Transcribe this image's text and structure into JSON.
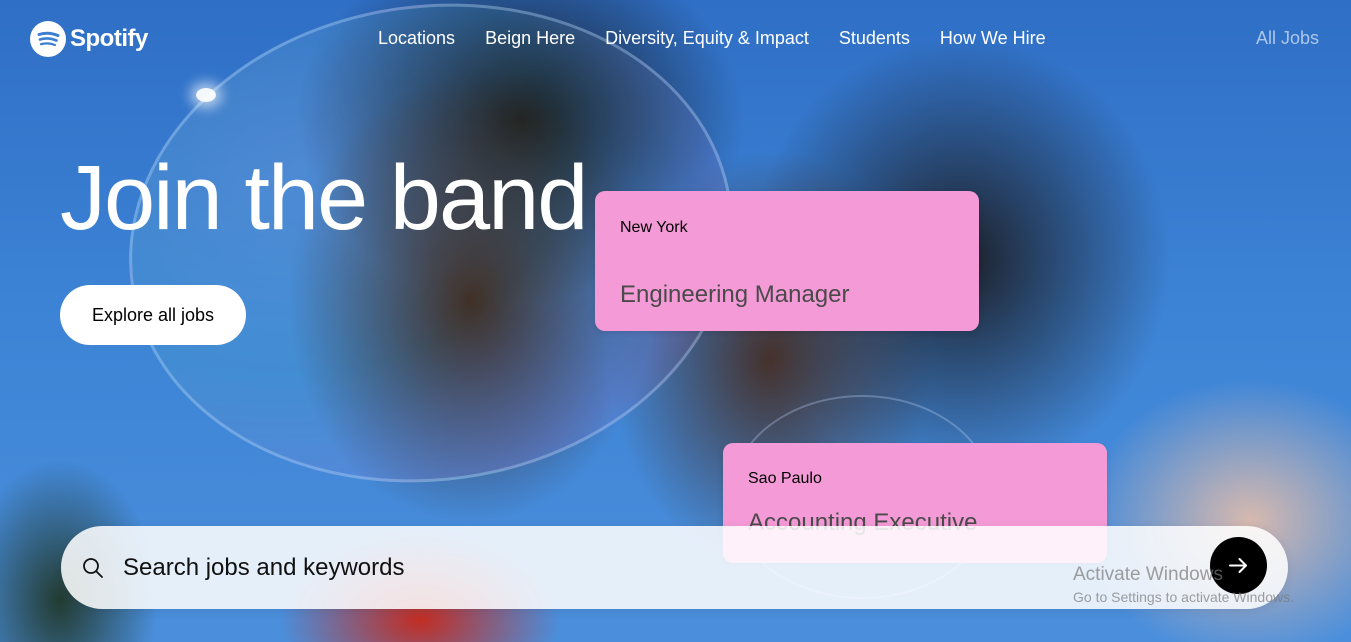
{
  "brand": {
    "name": "Spotify"
  },
  "nav": {
    "links": [
      "Locations",
      "Beign Here",
      "Diversity, Equity & Impact",
      "Students",
      "How We Hire"
    ],
    "all_jobs": "All Jobs"
  },
  "hero": {
    "headline": "Join the band",
    "cta": "Explore all jobs"
  },
  "job_cards": [
    {
      "location": "New York",
      "title": "Engineering Manager"
    },
    {
      "location": "Sao Paulo",
      "title": "Accounting Executive"
    }
  ],
  "search": {
    "placeholder": "Search jobs and keywords",
    "icon": "search-icon",
    "submit_icon": "arrow-right-icon"
  },
  "watermark": {
    "title": "Activate Windows",
    "subtitle": "Go to Settings to activate Windows."
  },
  "colors": {
    "card": "#f49ad6",
    "sky": "#3b7fd1",
    "submit_button": "#000000"
  }
}
